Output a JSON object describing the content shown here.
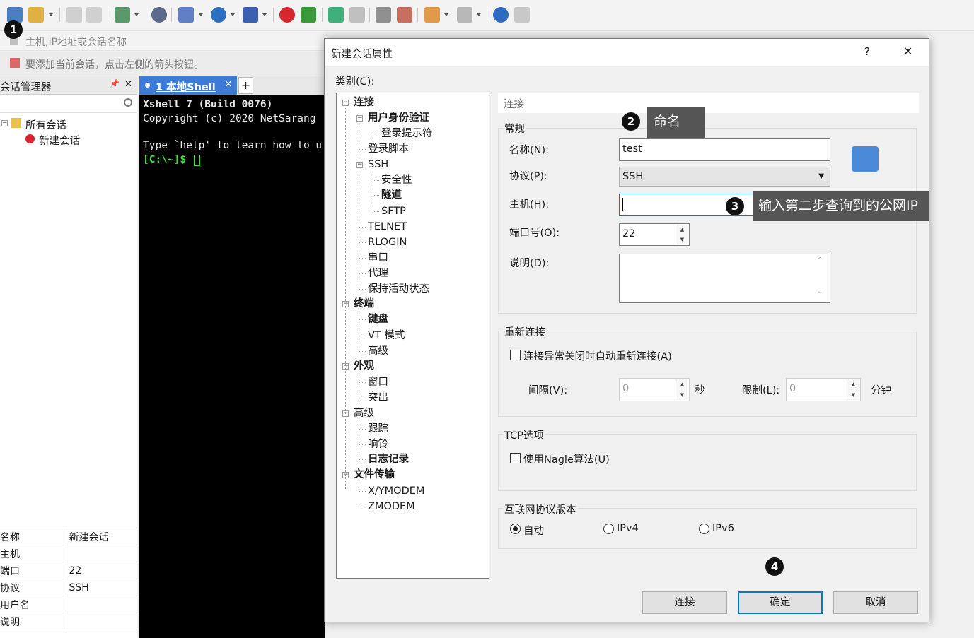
{
  "address_placeholder": "主机,IP地址或会话名称",
  "hint": "要添加当前会话，点击左侧的箭头按钮。",
  "session_manager": {
    "title": "会话管理器",
    "pin": "📌",
    "close": "✕",
    "root": "所有会话",
    "child": "新建会话"
  },
  "props": [
    {
      "k": "名称",
      "v": "新建会话"
    },
    {
      "k": "主机",
      "v": ""
    },
    {
      "k": "端口",
      "v": "22"
    },
    {
      "k": "协议",
      "v": "SSH"
    },
    {
      "k": "用户名",
      "v": ""
    },
    {
      "k": "说明",
      "v": ""
    }
  ],
  "tab": {
    "label": "1 本地Shell",
    "close": "×",
    "add": "+"
  },
  "terminal": {
    "l1": "Xshell 7 (Build 0076)",
    "l2": "Copyright (c) 2020 NetSarang",
    "l3": "Type `help' to learn how to u",
    "prompt": "[C:\\~]$ "
  },
  "dialog": {
    "title": "新建会话属性",
    "help": "?",
    "close": "✕",
    "category_label": "类别(C):",
    "section_header": "连接"
  },
  "tree": [
    {
      "t": "连接",
      "b": true
    },
    {
      "t": "用户身份验证",
      "b": true
    },
    {
      "t": "登录提示符"
    },
    {
      "t": "登录脚本"
    },
    {
      "t": "SSH"
    },
    {
      "t": "安全性"
    },
    {
      "t": "隧道",
      "b": true
    },
    {
      "t": "SFTP"
    },
    {
      "t": "TELNET"
    },
    {
      "t": "RLOGIN"
    },
    {
      "t": "串口"
    },
    {
      "t": "代理"
    },
    {
      "t": "保持活动状态"
    },
    {
      "t": "终端",
      "b": true
    },
    {
      "t": "键盘",
      "b": true
    },
    {
      "t": "VT 模式"
    },
    {
      "t": "高级"
    },
    {
      "t": "外观",
      "b": true
    },
    {
      "t": "窗口"
    },
    {
      "t": "突出"
    },
    {
      "t": "高级"
    },
    {
      "t": "跟踪"
    },
    {
      "t": "响铃"
    },
    {
      "t": "日志记录",
      "b": true
    },
    {
      "t": "文件传输",
      "b": true
    },
    {
      "t": "X/YMODEM"
    },
    {
      "t": "ZMODEM"
    }
  ],
  "general": {
    "title": "常规",
    "name_label": "名称(N):",
    "name_value": "test",
    "protocol_label": "协议(P):",
    "protocol_value": "SSH",
    "host_label": "主机(H):",
    "host_value": "",
    "port_label": "端口号(O):",
    "port_value": "22",
    "desc_label": "说明(D):",
    "desc_value": ""
  },
  "reconnect": {
    "title": "重新连接",
    "checkbox": "连接异常关闭时自动重新连接(A)",
    "interval_label": "间隔(V):",
    "interval_value": "0",
    "sec": "秒",
    "limit_label": "限制(L):",
    "limit_value": "0",
    "min": "分钟"
  },
  "tcp": {
    "title": "TCP选项",
    "checkbox": "使用Nagle算法(U)"
  },
  "ipver": {
    "title": "互联网协议版本",
    "opts": [
      "自动",
      "IPv4",
      "IPv6"
    ]
  },
  "buttons": {
    "connect": "连接",
    "ok": "确定",
    "cancel": "取消"
  },
  "annotations": {
    "b1": "1",
    "b2": "2",
    "b3": "3",
    "b4": "4",
    "c2": "命名",
    "c3": "输入第二步查询到的公网IP"
  }
}
